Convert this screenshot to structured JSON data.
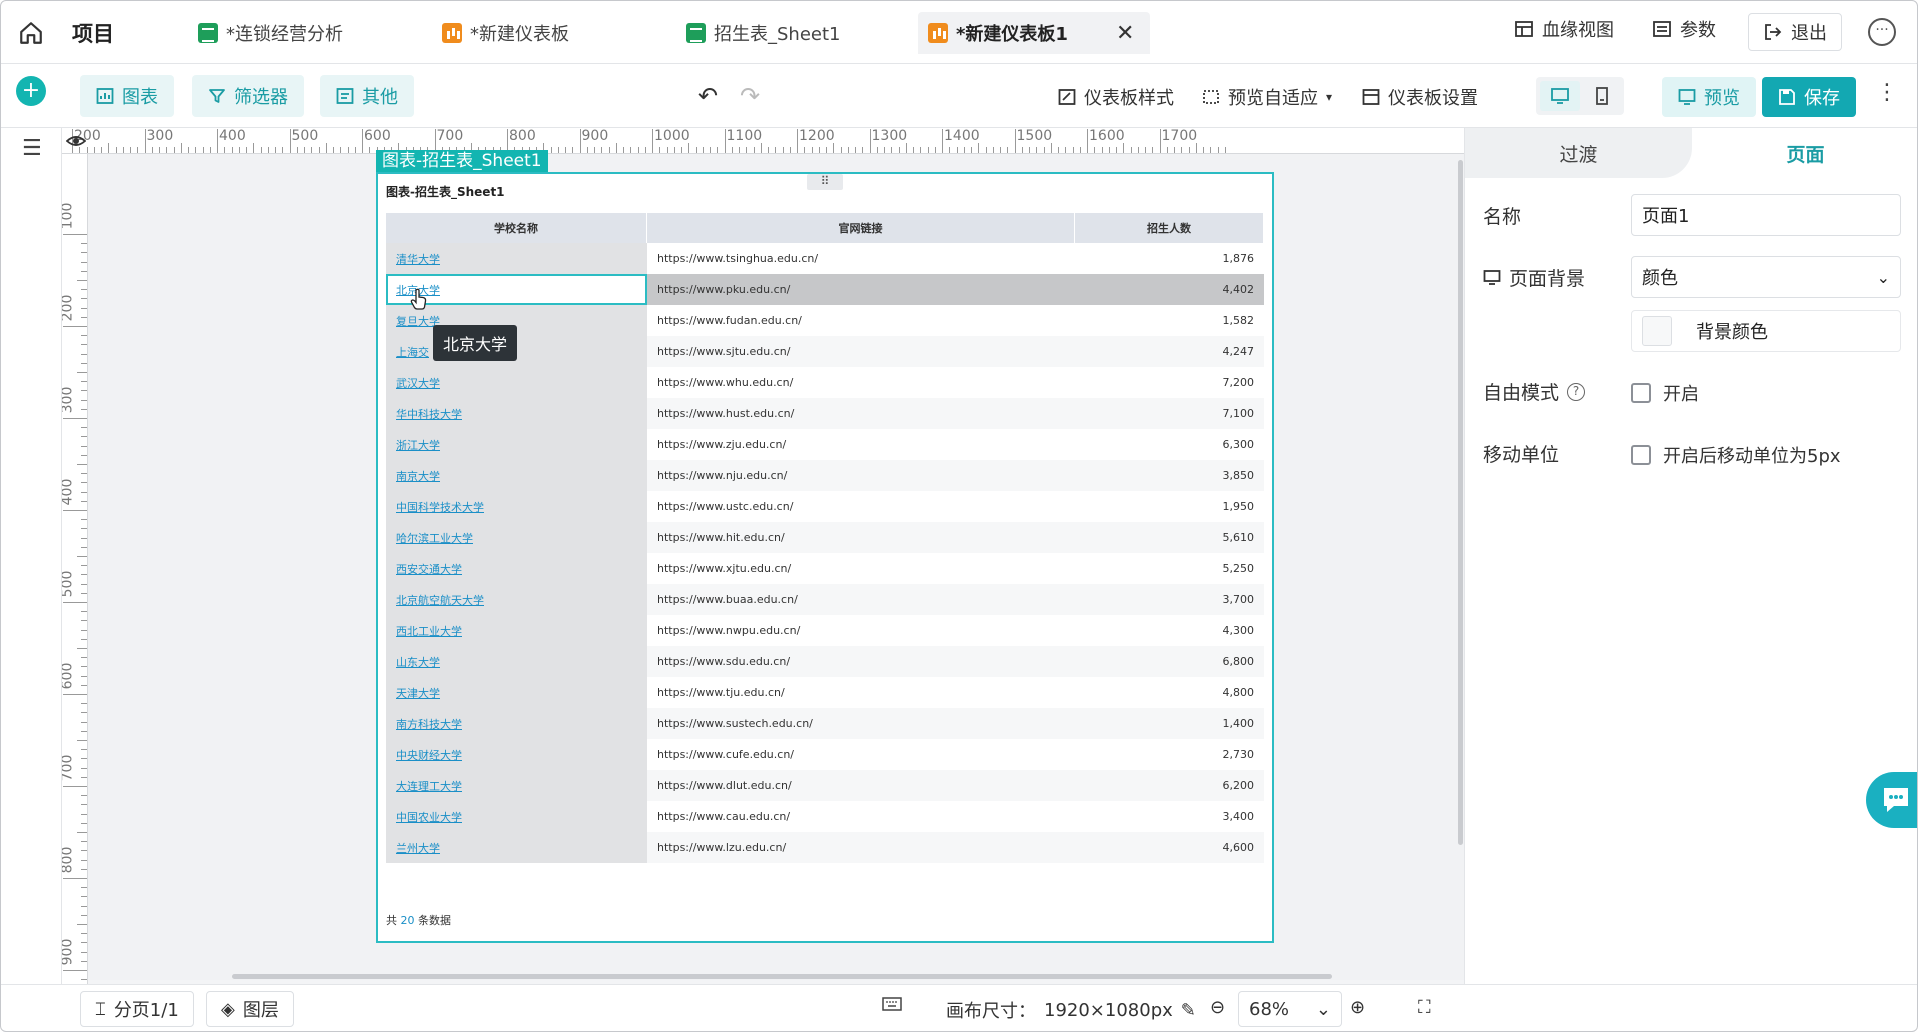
{
  "topbar": {
    "project_title": "项目",
    "tabs": [
      {
        "label": "*连锁经营分析",
        "icon": "sheet-icon"
      },
      {
        "label": "*新建仪表板",
        "icon": "dashboard-icon"
      },
      {
        "label": "招生表_Sheet1",
        "icon": "sheet-icon"
      },
      {
        "label": "*新建仪表板1",
        "icon": "dashboard-icon",
        "active": true,
        "close": "✕"
      }
    ],
    "lineage_label": "血缘视图",
    "params_label": "参数",
    "exit_label": "退出"
  },
  "toolbar": {
    "chart_label": "图表",
    "filter_label": "筛选器",
    "other_label": "其他",
    "dashboard_style_label": "仪表板样式",
    "preview_fit_label": "预览自适应",
    "dashboard_settings_label": "仪表板设置",
    "preview_label": "预览",
    "save_label": "保存"
  },
  "ruler": {
    "top_ticks": [
      "200",
      "300",
      "400",
      "500",
      "600",
      "700",
      "800",
      "900",
      "1000",
      "1100",
      "1200",
      "1300",
      "1400",
      "1500",
      "1600",
      "1700"
    ],
    "left_ticks": [
      "100",
      "200",
      "300",
      "400",
      "500",
      "600",
      "700",
      "800",
      "900"
    ]
  },
  "widget": {
    "tag": "图表-招生表_Sheet1",
    "title": "图表-招生表_Sheet1",
    "columns": [
      "学校名称",
      "官网链接",
      "招生人数"
    ],
    "rows": [
      [
        "清华大学",
        "https://www.tsinghua.edu.cn/",
        "1,876"
      ],
      [
        "北京大学",
        "https://www.pku.edu.cn/",
        "4,402"
      ],
      [
        "复旦大学",
        "https://www.fudan.edu.cn/",
        "1,582"
      ],
      [
        "上海交",
        "https://www.sjtu.edu.cn/",
        "4,247"
      ],
      [
        "武汉大学",
        "https://www.whu.edu.cn/",
        "7,200"
      ],
      [
        "华中科技大学",
        "https://www.hust.edu.cn/",
        "7,100"
      ],
      [
        "浙江大学",
        "https://www.zju.edu.cn/",
        "6,300"
      ],
      [
        "南京大学",
        "https://www.nju.edu.cn/",
        "3,850"
      ],
      [
        "中国科学技术大学",
        "https://www.ustc.edu.cn/",
        "1,950"
      ],
      [
        "哈尔滨工业大学",
        "https://www.hit.edu.cn/",
        "5,610"
      ],
      [
        "西安交通大学",
        "https://www.xjtu.edu.cn/",
        "5,250"
      ],
      [
        "北京航空航天大学",
        "https://www.buaa.edu.cn/",
        "3,700"
      ],
      [
        "西北工业大学",
        "https://www.nwpu.edu.cn/",
        "4,300"
      ],
      [
        "山东大学",
        "https://www.sdu.edu.cn/",
        "6,800"
      ],
      [
        "天津大学",
        "https://www.tju.edu.cn/",
        "4,800"
      ],
      [
        "南方科技大学",
        "https://www.sustech.edu.cn/",
        "1,400"
      ],
      [
        "中央财经大学",
        "https://www.cufe.edu.cn/",
        "2,730"
      ],
      [
        "大连理工大学",
        "https://www.dlut.edu.cn/",
        "6,200"
      ],
      [
        "中国农业大学",
        "https://www.cau.edu.cn/",
        "3,400"
      ],
      [
        "兰州大学",
        "https://www.lzu.edu.cn/",
        "4,600"
      ]
    ],
    "footer_prefix": "共",
    "footer_count": "20",
    "footer_suffix": "条数据",
    "tooltip": "北京大学"
  },
  "panel": {
    "tab_transition": "过渡",
    "tab_page": "页面",
    "name_label": "名称",
    "name_value": "页面1",
    "bg_label": "页面背景",
    "bg_value": "颜色",
    "bg_color_label": "背景颜色",
    "free_mode_label": "自由模式",
    "free_mode_option": "开启",
    "move_unit_label": "移动单位",
    "move_unit_option": "开启后移动单位为5px"
  },
  "bottombar": {
    "pages_label": "分页1/1",
    "layers_label": "图层",
    "canvas_size_label": "画布尺寸：",
    "canvas_size_value": "1920×1080px",
    "zoom_value": "68%"
  },
  "colors": {
    "accent": "#13a8b2",
    "link": "#1a8fc7"
  }
}
